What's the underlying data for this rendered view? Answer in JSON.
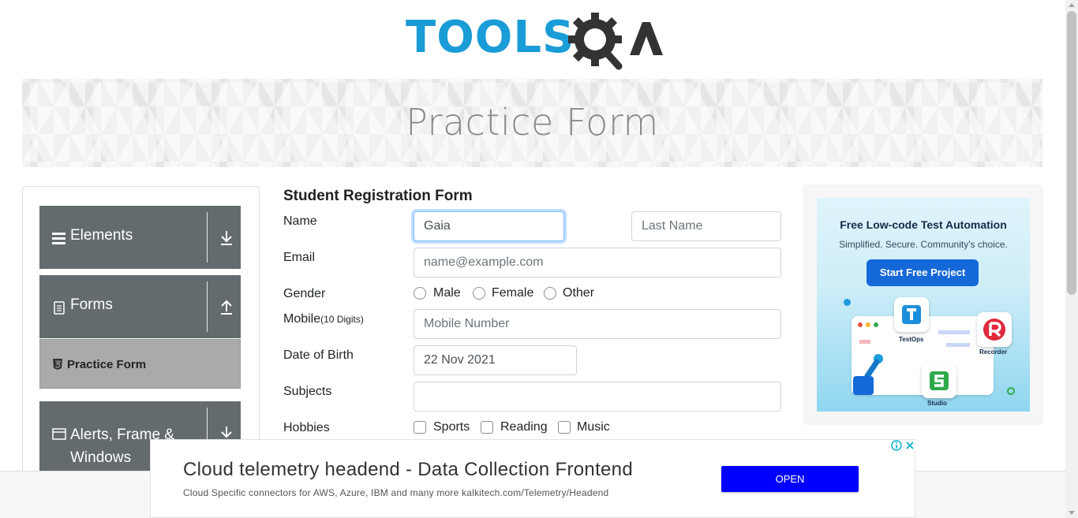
{
  "header": {
    "logo_text_left": "TOOLS",
    "logo_text_right": "A"
  },
  "banner": {
    "title": "Practice Form"
  },
  "sidebar": {
    "groups": [
      {
        "label": "Elements",
        "icon": "hamburger-icon",
        "arrow": "download-arrow-icon"
      },
      {
        "label": "Forms",
        "icon": "document-icon",
        "arrow": "upload-arrow-icon"
      },
      {
        "label": "Alerts, Frame & Windows",
        "icon": "window-icon",
        "arrow": "download-arrow-icon"
      }
    ],
    "active_item": {
      "label": "Practice Form",
      "icon": "html5-icon"
    }
  },
  "form": {
    "title": "Student Registration Form",
    "name_label": "Name",
    "first_name_value": "Gaia",
    "last_name_placeholder": "Last Name",
    "email_label": "Email",
    "email_placeholder": "name@example.com",
    "gender_label": "Gender",
    "gender_options": [
      "Male",
      "Female",
      "Other"
    ],
    "mobile_label": "Mobile",
    "mobile_hint": "(10 Digits)",
    "mobile_placeholder": "Mobile Number",
    "dob_label": "Date of Birth",
    "dob_value": "22 Nov 2021",
    "subjects_label": "Subjects",
    "subjects_value": "",
    "hobbies_label": "Hobbies",
    "hobbies_options": [
      "Sports",
      "Reading",
      "Music"
    ]
  },
  "side_ad": {
    "title": "Free Low-code Test Automation",
    "subtitle": "Simplified. Secure. Community's choice.",
    "button": "Start Free Project",
    "tiles": [
      "TestOps",
      "Recorder",
      "Studio"
    ],
    "colors": {
      "button": "#1468d8",
      "testops": "#1c8fdc",
      "recorder": "#e02a3b",
      "studio": "#2eaa4b"
    }
  },
  "bottom_ad": {
    "title": "Cloud telemetry headend - Data Collection Frontend",
    "subtitle": "Cloud Specific connectors for AWS, Azure, IBM and many more kalkitech.com/Telemetry/Headend",
    "button": "OPEN",
    "color": "#0000ff"
  },
  "colors": {
    "brand_blue": "#1a9cd6",
    "sidebar_header": "#636b6f",
    "active_item": "#aaaaaa"
  }
}
